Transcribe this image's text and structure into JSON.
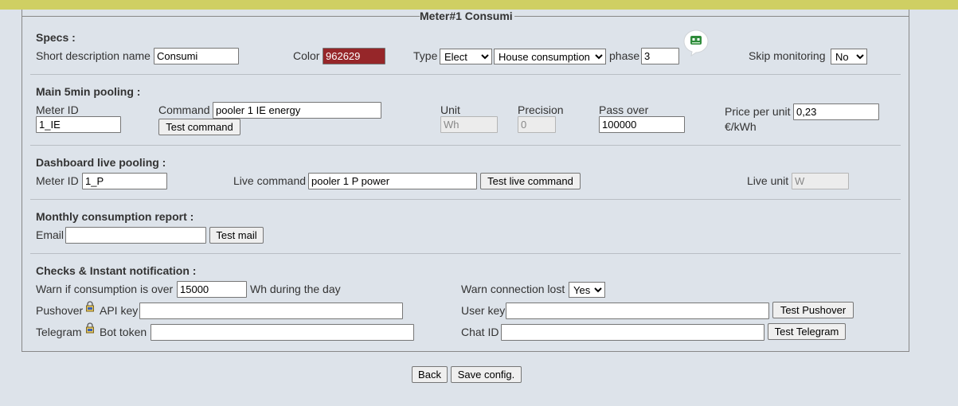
{
  "window": {
    "title": "Meter#1 Consumi"
  },
  "specs": {
    "heading": "Specs :",
    "short_desc_label": "Short description name",
    "short_desc_value": "Consumi",
    "color_label": "Color",
    "color_value": "962629",
    "color_hex": "#962629",
    "type_label": "Type",
    "type_value": "Elect",
    "category_value": "House consumption",
    "phase_label": "phase",
    "phase_value": "3",
    "skip_label": "Skip monitoring",
    "skip_value": "No",
    "robot_icon": "robot-icon"
  },
  "pooling": {
    "heading": "Main 5min pooling :",
    "meter_id_label": "Meter ID",
    "meter_id_value": "1_IE",
    "command_label": "Command",
    "command_value": "pooler 1 IE energy",
    "test_command_label": "Test command",
    "unit_label": "Unit",
    "unit_value": "Wh",
    "precision_label": "Precision",
    "precision_value": "0",
    "pass_over_label": "Pass over",
    "pass_over_value": "100000",
    "price_label": "Price per unit",
    "price_value": "0,23",
    "price_unit": "€/kWh"
  },
  "live": {
    "heading": "Dashboard live pooling :",
    "meter_id_label": "Meter ID",
    "meter_id_value": "1_P",
    "live_command_label": "Live command",
    "live_command_value": "pooler 1 P power",
    "test_live_label": "Test live command",
    "live_unit_label": "Live unit",
    "live_unit_value": "W"
  },
  "report": {
    "heading": "Monthly consumption report :",
    "email_label": "Email",
    "email_value": "",
    "test_mail_label": "Test mail"
  },
  "checks": {
    "heading": "Checks & Instant notification :",
    "warn_label": "Warn if consumption is over",
    "warn_value": "15000",
    "warn_suffix": "Wh during the day",
    "warn_conn_label": "Warn connection lost",
    "warn_conn_value": "Yes",
    "pushover_label": "Pushover",
    "api_key_label": "API key",
    "api_key_value": "",
    "user_key_label": "User key",
    "user_key_value": "",
    "test_pushover_label": "Test Pushover",
    "telegram_label": "Telegram",
    "bot_token_label": "Bot token",
    "bot_token_value": "",
    "chat_id_label": "Chat ID",
    "chat_id_value": "",
    "test_telegram_label": "Test Telegram"
  },
  "footer": {
    "back_label": "Back",
    "save_label": "Save config."
  }
}
